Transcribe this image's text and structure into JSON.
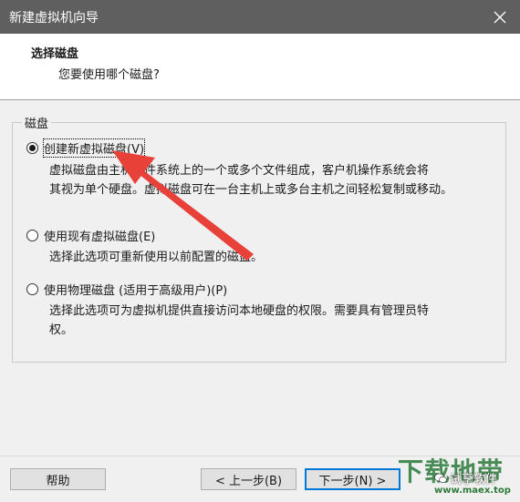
{
  "window": {
    "title": "新建虚拟机向导",
    "close_icon": "close-icon"
  },
  "header": {
    "title": "选择磁盘",
    "subtitle": "您要使用哪个磁盘?"
  },
  "group": {
    "legend": "磁盘"
  },
  "options": [
    {
      "label": "创建新虚拟磁盘(V)",
      "checked": true,
      "description_lines": [
        "虚拟磁盘由主机文件系统上的一个或多个文件组成，客户机操作系统会将",
        "其视为单个硬盘。虚拟磁盘可在一台主机上或多台主机之间轻松复制或移动。"
      ]
    },
    {
      "label": "使用现有虚拟磁盘(E)",
      "checked": false,
      "description_lines": [
        "选择此选项可重新使用以前配置的磁盘。"
      ]
    },
    {
      "label": "使用物理磁盘 (适用于高级用户)(P)",
      "checked": false,
      "description_lines": [
        "选择此选项可为虚拟机提供直接访问本地硬盘的权限。需要具有管理员特",
        "权。"
      ]
    }
  ],
  "buttons": {
    "help": "帮助",
    "back": "< 上一步(B)",
    "next": "下一步(N) >"
  },
  "watermark": {
    "big": "下载地带",
    "url": "www.maex.top",
    "wechat": "试享软件"
  },
  "colors": {
    "titlebar": "#5f5f5f",
    "accent_border": "#0078d7",
    "arrow": "#e8413a"
  }
}
